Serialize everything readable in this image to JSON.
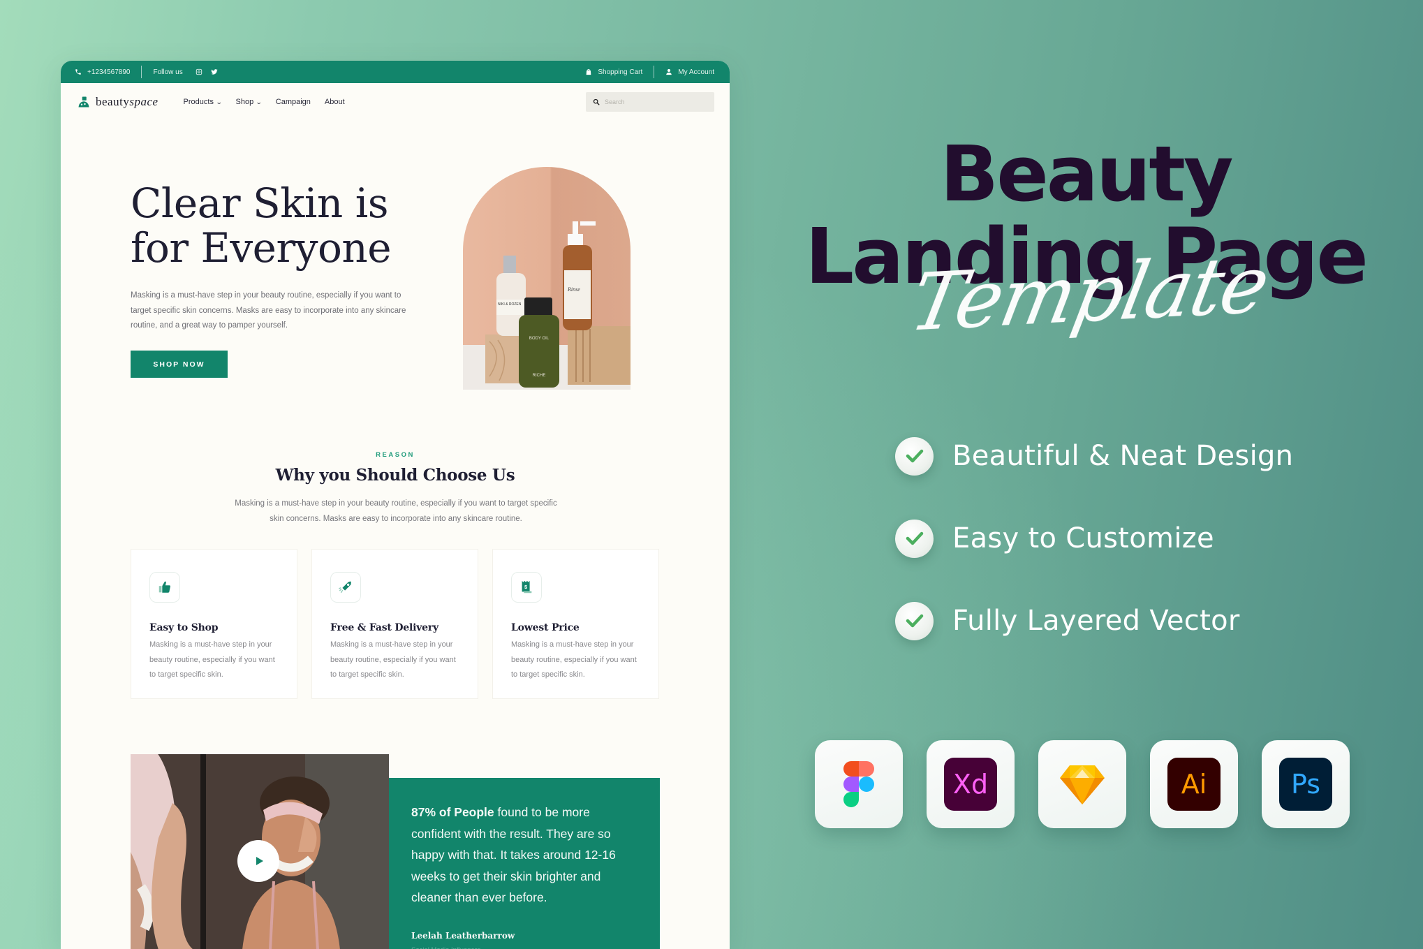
{
  "mockup": {
    "topbar": {
      "phone": "+1234567890",
      "follow_label": "Follow us",
      "social": [
        "instagram",
        "twitter"
      ],
      "cart_label": "Shopping Cart",
      "account_label": "My Account"
    },
    "nav": {
      "logo_regular": "beauty",
      "logo_italic": "space",
      "items": [
        {
          "label": "Products",
          "dropdown": true
        },
        {
          "label": "Shop",
          "dropdown": true
        },
        {
          "label": "Campaign",
          "dropdown": false
        },
        {
          "label": "About",
          "dropdown": false
        }
      ],
      "search_placeholder": "Search"
    },
    "hero": {
      "title_line1": "Clear Skin is",
      "title_line2": "for Everyone",
      "text": "Masking is a must-have step in your beauty routine, especially if you want to target specific skin concerns. Masks are easy to incorporate into any skincare routine, and a great way to pamper yourself.",
      "button": "SHOP NOW",
      "image_alt": "Skincare products: perfume, body oil and pump bottle",
      "product_labels": [
        "BODY OIL",
        "RICHE"
      ]
    },
    "reason": {
      "kicker": "REASON",
      "title": "Why you Should Choose Us",
      "text": "Masking is a must-have step in your beauty routine, especially if you want to target specific skin concerns. Masks are easy to incorporate into any skincare routine.",
      "cards": [
        {
          "icon": "thumbs-up-icon",
          "title": "Easy to Shop",
          "text": "Masking is a must-have step in your beauty routine, especially if you want to target specific skin."
        },
        {
          "icon": "rocket-icon",
          "title": "Free & Fast Delivery",
          "text": "Masking is a must-have step in your beauty routine, especially if you want to target specific skin."
        },
        {
          "icon": "receipt-dollar-icon",
          "title": "Lowest Price",
          "text": "Masking is a must-have step in your beauty routine, especially if you want to target specific skin."
        }
      ]
    },
    "testimonial": {
      "highlight": "87% of People",
      "text": " found to be more confident with the result. They are so happy with that. It takes around 12-16 weeks to get their skin brighter and cleaner than ever before.",
      "name": "Leelah Leatherbarrow",
      "role": "Social Media Influencer"
    }
  },
  "promo": {
    "title_line1": "Beauty",
    "title_line2": "Landing Page",
    "script": "Template",
    "features": [
      "Beautiful & Neat Design",
      "Easy to Customize",
      "Fully Layered Vector"
    ],
    "tools": [
      {
        "name": "Figma",
        "label": ""
      },
      {
        "name": "Adobe XD",
        "label": "Xd"
      },
      {
        "name": "Sketch",
        "label": ""
      },
      {
        "name": "Adobe Illustrator",
        "label": "Ai"
      },
      {
        "name": "Adobe Photoshop",
        "label": "Ps"
      }
    ]
  },
  "colors": {
    "brand_green": "#12856b",
    "heading_dark": "#1f1f33",
    "promo_title": "#220d2e",
    "page_bg": "#fdfcf7"
  }
}
